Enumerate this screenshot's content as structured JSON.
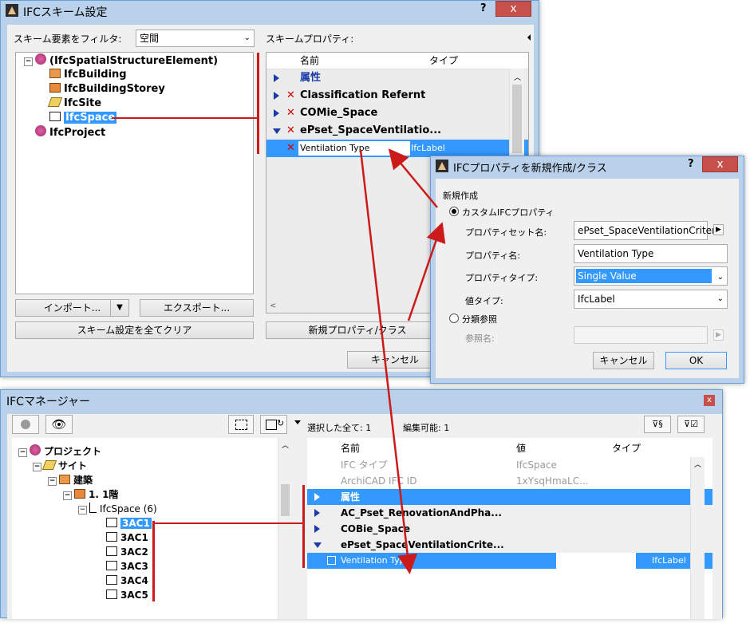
{
  "scheme_window": {
    "title": "IFCスキーム設定",
    "help": "?",
    "close": "x",
    "filter_label": "スキーム要素をフィルタ:",
    "filter_value": "空間",
    "props_label": "スキームプロパティ:",
    "tree": [
      {
        "label": "(IfcSpatialStructureElement)",
        "icon": "spatial-structure-icon"
      },
      {
        "label": "IfcBuilding",
        "icon": "building-icon"
      },
      {
        "label": "IfcBuildingStorey",
        "icon": "storey-icon"
      },
      {
        "label": "IfcSite",
        "icon": "site-icon"
      },
      {
        "label": "IfcSpace",
        "icon": "space-icon"
      },
      {
        "label": "IfcProject",
        "icon": "project-icon"
      }
    ],
    "grid_headers": {
      "name": "名前",
      "type": "タイプ"
    },
    "grid_rows": [
      {
        "name": "属性",
        "type": ""
      },
      {
        "name": "Classification Refernt",
        "type": ""
      },
      {
        "name": "COMie_Space",
        "type": ""
      },
      {
        "name": "ePset_SpaceVentilatio...",
        "type": ""
      },
      {
        "name": "Ventilation Type",
        "type": "IfcLabel"
      }
    ],
    "import_button": "インポート...",
    "export_button": "エクスポート...",
    "clear_button": "スキーム設定を全てクリア",
    "new_prop_button": "新規プロパティ/クラス",
    "cancel_button": "キャンセル"
  },
  "new_prop_dialog": {
    "title": "IFCプロパティを新規作成/クラス",
    "help": "?",
    "close": "x",
    "section_label": "新規作成",
    "radio_custom": "カスタムIFCプロパティ",
    "propset_label": "プロパティセット名:",
    "propset_value": "ePset_SpaceVentilationCriteri",
    "propname_label": "プロパティ名:",
    "propname_value": "Ventilation Type",
    "proptype_label": "プロパティタイプ:",
    "proptype_value": "Single Value",
    "valuetype_label": "値タイプ:",
    "valuetype_value": "IfcLabel",
    "radio_class": "分類参照",
    "refname_label": "参照名:",
    "cancel_button": "キャンセル",
    "ok_button": "OK"
  },
  "manager_window": {
    "title": "IFCマネージャー",
    "close": "x",
    "selected_text": "選択した全て: 1",
    "editable_text": "編集可能: 1",
    "tree": [
      {
        "label": "プロジェクト",
        "level": 0
      },
      {
        "label": "サイト",
        "level": 1
      },
      {
        "label": "建築",
        "level": 2
      },
      {
        "label": "1. 1階",
        "level": 3
      },
      {
        "label": "IfcSpace (6)",
        "level": 4
      },
      {
        "label": "3AC1",
        "level": 5
      },
      {
        "label": "3AC1",
        "level": 5
      },
      {
        "label": "3AC2",
        "level": 5
      },
      {
        "label": "3AC3",
        "level": 5
      },
      {
        "label": "3AC4",
        "level": 5
      },
      {
        "label": "3AC5",
        "level": 5
      }
    ],
    "grid_headers": {
      "name": "名前",
      "value": "値",
      "type": "タイプ"
    },
    "grid_rows": [
      {
        "name": "IFC タイプ",
        "value": "IfcSpace",
        "type": ""
      },
      {
        "name": "ArchiCAD IFC ID",
        "value": "1xYsqHmaLC...",
        "type": ""
      },
      {
        "name": "属性",
        "value": "",
        "type": ""
      },
      {
        "name": "AC_Pset_RenovationAndPha...",
        "value": "",
        "type": ""
      },
      {
        "name": "COBie_Space",
        "value": "",
        "type": ""
      },
      {
        "name": "ePset_SpaceVentilationCrite...",
        "value": "",
        "type": ""
      },
      {
        "name": "Ventilation Type",
        "value": "",
        "type": "IfcLabel"
      }
    ]
  },
  "colors": {
    "accent": "#3399ff",
    "annotation": "#cc1a1a",
    "title_bar": "#b9d1ea"
  }
}
